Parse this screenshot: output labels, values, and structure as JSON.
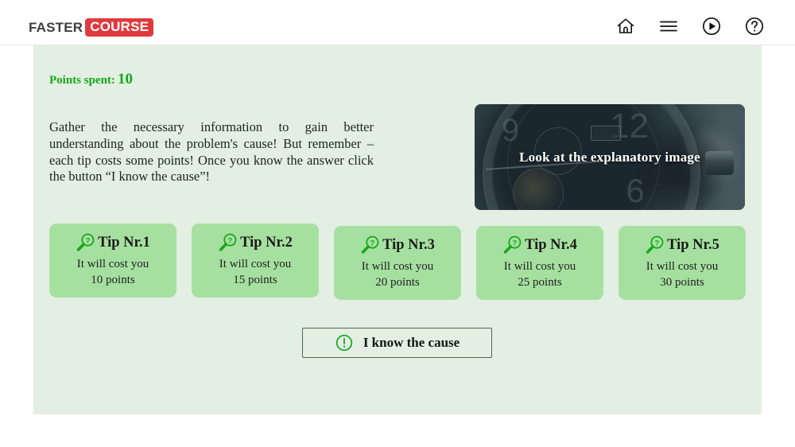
{
  "header": {
    "logo_primary": "FASTER",
    "logo_secondary": "COURSE",
    "logo_badge_color": "#e03a3e",
    "icons": [
      {
        "name": "home-icon",
        "label": "Home"
      },
      {
        "name": "menu-icon",
        "label": "Menu"
      },
      {
        "name": "play-icon",
        "label": "Play"
      },
      {
        "name": "help-icon",
        "label": "Help"
      }
    ]
  },
  "panel": {
    "background_color": "#e2efe2",
    "points_label": "Points spent:",
    "points_value": "10",
    "points_color": "#14a81c",
    "body_text": "Gather the necessary information to gain better understanding about the problem's cause! But remember – each tip costs some points! Once you know the answer click the button “I know the cause”!"
  },
  "explanatory_image": {
    "caption": "Look at the explanatory image",
    "subject": "close-up photo of a mechanical wrist watch dial"
  },
  "tips": [
    {
      "title": "Tip Nr.1",
      "cost_line1": "It will cost you",
      "cost_line2": "10 points",
      "icon": "magnifier-question-icon"
    },
    {
      "title": "Tip Nr.2",
      "cost_line1": "It will cost you",
      "cost_line2": "15 points",
      "icon": "magnifier-question-icon"
    },
    {
      "title": "Tip Nr.3",
      "cost_line1": "It will cost you",
      "cost_line2": "20 points",
      "icon": "magnifier-question-icon"
    },
    {
      "title": "Tip Nr.4",
      "cost_line1": "It will cost you",
      "cost_line2": "25 points",
      "icon": "magnifier-question-icon"
    },
    {
      "title": "Tip Nr.5",
      "cost_line1": "It will cost you",
      "cost_line2": "30 points",
      "icon": "magnifier-question-icon"
    }
  ],
  "cause_button": {
    "label": "I know the cause",
    "icon": "exclamation-circle-icon",
    "icon_color": "#16a31b",
    "border_color": "#4b6b4e"
  },
  "colors": {
    "card_green": "#a6e0a1",
    "panel_green": "#e2efe2",
    "accent_green": "#14a81c",
    "brand_red": "#e03a3e"
  }
}
